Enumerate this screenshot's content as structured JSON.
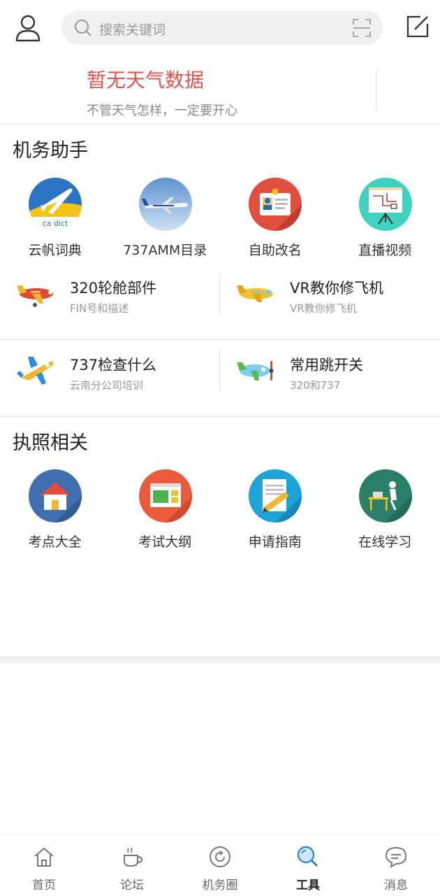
{
  "search": {
    "placeholder": "搜索关键词"
  },
  "weather": {
    "title": "暂无天气数据",
    "subtitle": "不管天气怎样，一定要开心"
  },
  "assistant": {
    "title": "机务助手",
    "icons": [
      {
        "label": "云帆词典",
        "icon": "airplane-logo-icon"
      },
      {
        "label": "737AMM目录",
        "icon": "jet-photo-icon"
      },
      {
        "label": "自助改名",
        "icon": "id-card-icon"
      },
      {
        "label": "直播视频",
        "icon": "whiteboard-icon"
      }
    ],
    "features": [
      {
        "title": "320轮舱部件",
        "subtitle": "FIN号和描述",
        "icon": "red-plane-icon"
      },
      {
        "title": "VR教你修飞机",
        "subtitle": "VR教你修飞机",
        "icon": "yellow-plane-icon"
      },
      {
        "title": "737检查什么",
        "subtitle": "云南分公司培训",
        "icon": "toy-plane-icon"
      },
      {
        "title": "常用跳开关",
        "subtitle": "320和737",
        "icon": "propeller-plane-icon"
      }
    ]
  },
  "license": {
    "title": "执照相关",
    "icons": [
      {
        "label": "考点大全",
        "icon": "house-icon"
      },
      {
        "label": "考试大纲",
        "icon": "browser-window-icon"
      },
      {
        "label": "申请指南",
        "icon": "document-pencil-icon"
      },
      {
        "label": "在线学习",
        "icon": "person-at-desk-icon"
      }
    ]
  },
  "tabs": [
    {
      "label": "首页",
      "icon": "home-icon",
      "active": false
    },
    {
      "label": "论坛",
      "icon": "coffee-cup-icon",
      "active": false
    },
    {
      "label": "机务圈",
      "icon": "refresh-circle-icon",
      "active": false
    },
    {
      "label": "工具",
      "icon": "search-tools-icon",
      "active": true
    },
    {
      "label": "消息",
      "icon": "chat-bubble-icon",
      "active": false
    }
  ],
  "colors": {
    "accent_red": "#e5524c",
    "active_tab": "#222222",
    "inactive_tab": "#666666"
  }
}
